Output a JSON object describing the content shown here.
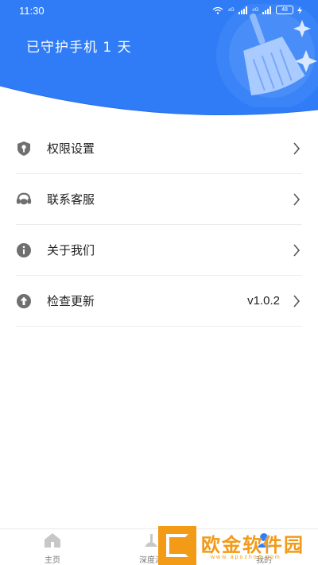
{
  "status_bar": {
    "time": "11:30",
    "signal_text": "⁴ᴳ",
    "battery": "48"
  },
  "header": {
    "protect_text": "已守护手机 1 天",
    "bg_color": "#2f7cf6"
  },
  "menu": {
    "items": [
      {
        "label": "权限设置",
        "icon": "shield-key-icon"
      },
      {
        "label": "联系客服",
        "icon": "headset-icon"
      },
      {
        "label": "关于我们",
        "icon": "info-icon"
      },
      {
        "label": "检查更新",
        "icon": "upload-icon",
        "value": "v1.0.2"
      }
    ]
  },
  "bottom_nav": {
    "items": [
      {
        "label": "主页",
        "icon": "home-icon"
      },
      {
        "label": "深度清",
        "icon": "clean-icon"
      },
      {
        "label": "我的",
        "icon": "profile-icon"
      }
    ]
  },
  "watermark": {
    "text": "欧金软件园",
    "url": "www.apozhon.com",
    "color": "#f39a16"
  }
}
